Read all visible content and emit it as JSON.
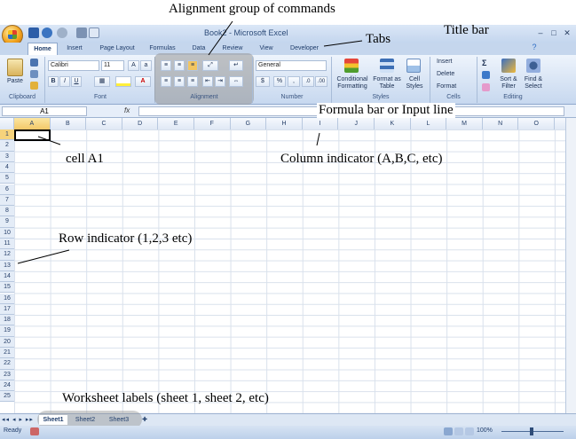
{
  "window": {
    "title": "Book2 - Microsoft Excel",
    "controls": [
      "–",
      "□",
      "✕"
    ]
  },
  "ribbon": {
    "tabs": [
      "Home",
      "Insert",
      "Page Layout",
      "Formulas",
      "Data",
      "Review",
      "View",
      "Developer"
    ],
    "active_tab": "Home",
    "clipboard": {
      "paste_label": "Paste",
      "group_label": "Clipboard"
    },
    "font": {
      "font_name": "Calibri",
      "font_size": "11",
      "bold": "B",
      "italic": "I",
      "underline": "U",
      "group_label": "Font"
    },
    "alignment": {
      "group_label": "Alignment"
    },
    "number": {
      "format": "General",
      "currency": "$",
      "percent": "%",
      "comma": ",",
      "group_label": "Number"
    },
    "styles": {
      "conditional_formatting": "Conditional Formatting",
      "format_as_table": "Format as Table",
      "cell_styles": "Cell Styles",
      "group_label": "Styles"
    },
    "cells": {
      "insert": "Insert",
      "delete": "Delete",
      "format": "Format",
      "group_label": "Cells"
    },
    "editing": {
      "sigma": "Σ",
      "sort_filter": "Sort & Filter",
      "find_select": "Find & Select",
      "group_label": "Editing"
    }
  },
  "formula_bar": {
    "name_box": "A1",
    "fx": "fx",
    "value": ""
  },
  "grid": {
    "columns": [
      "A",
      "B",
      "C",
      "D",
      "E",
      "F",
      "G",
      "H",
      "I",
      "J",
      "K",
      "L",
      "M",
      "N",
      "O"
    ],
    "rows": [
      "1",
      "2",
      "3",
      "4",
      "5",
      "6",
      "7",
      "8",
      "9",
      "10",
      "11",
      "12",
      "13",
      "14",
      "15",
      "16",
      "17",
      "18",
      "19",
      "20",
      "21",
      "22",
      "23",
      "24",
      "25"
    ],
    "selected_cell": "A1"
  },
  "sheets": [
    "Sheet1",
    "Sheet2",
    "Sheet3"
  ],
  "status": {
    "text": "Ready",
    "zoom": "100%"
  },
  "annotations": {
    "alignment_group": "Alignment group of commands",
    "title_bar": "Title bar",
    "tabs": "Tabs",
    "formula_bar": "Formula bar or Input line",
    "cell_a1": "cell A1",
    "column_indicator": "Column indicator (A,B,C, etc)",
    "row_indicator": "Row indicator (1,2,3 etc)",
    "worksheet_labels": "Worksheet labels (sheet 1, sheet 2, etc)"
  },
  "colors": {
    "accent": "#c5d6ed",
    "selection": "#f6d37c"
  }
}
